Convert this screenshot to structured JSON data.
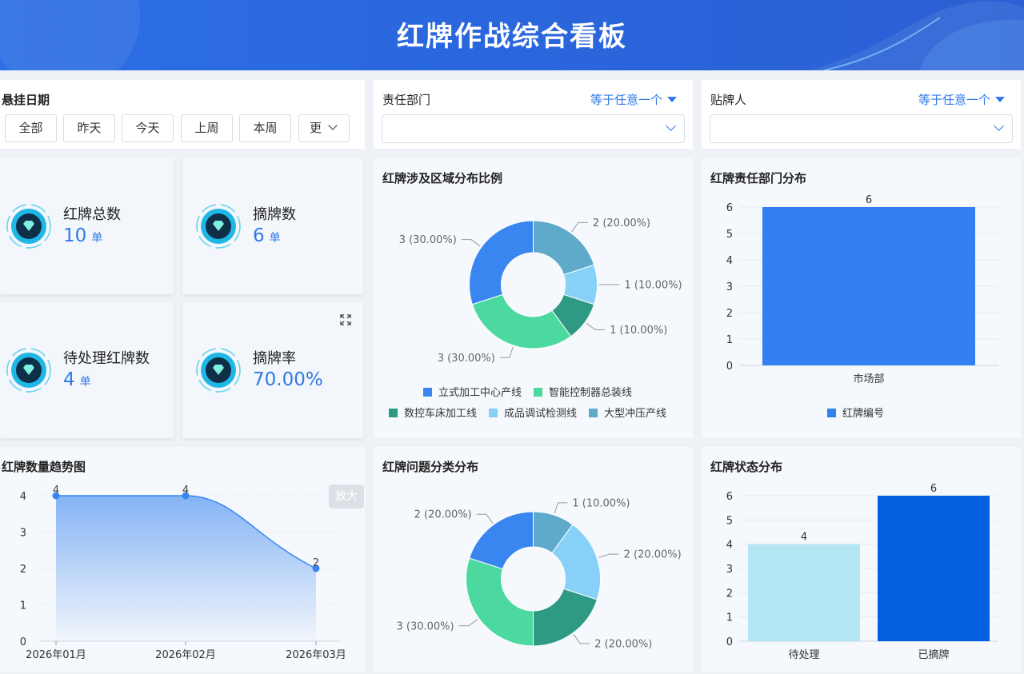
{
  "header": {
    "title": "红牌作战综合看板"
  },
  "filters": {
    "date": {
      "label": "悬挂日期",
      "buttons": [
        "全部",
        "昨天",
        "今天",
        "上周",
        "本周",
        "更"
      ]
    },
    "department": {
      "label": "责任部门",
      "operator": "等于任意一个",
      "value": ""
    },
    "poster": {
      "label": "贴牌人",
      "operator": "等于任意一个",
      "value": ""
    }
  },
  "kpis": [
    {
      "label": "红牌总数",
      "value": "10",
      "unit": "单"
    },
    {
      "label": "摘牌数",
      "value": "6",
      "unit": "单"
    },
    {
      "label": "待处理红牌数",
      "value": "4",
      "unit": "单"
    },
    {
      "label": "摘牌率",
      "value": "70.00%",
      "unit": ""
    }
  ],
  "colors": {
    "accent": "#2f7ae8",
    "blue": "#3a86f0",
    "green": "#4cd9a0",
    "teal": "#2e9a84",
    "lightblue": "#87d0f8",
    "slate": "#5faacb",
    "bar_blue": "#3381f0",
    "bar_light": "#b5e6f3",
    "bar_dark": "#0560e0"
  },
  "charts": {
    "region": {
      "title": "红牌涉及区域分布比例"
    },
    "dept": {
      "title": "红牌责任部门分布"
    },
    "trend": {
      "title": "红牌数量趋势图",
      "zoom_tip": "放大"
    },
    "issue": {
      "title": "红牌问题分类分布"
    },
    "status": {
      "title": "红牌状态分布"
    }
  },
  "chart_data": [
    {
      "id": "region",
      "type": "pie",
      "title": "红牌涉及区域分布比例",
      "slices": [
        {
          "name": "大型冲压产线",
          "value": 2,
          "label": "2 (20.00%)",
          "color": "#5faacb"
        },
        {
          "name": "成品调试检测线",
          "value": 1,
          "label": "1 (10.00%)",
          "color": "#87d0f8"
        },
        {
          "name": "数控车床加工线",
          "value": 1,
          "label": "1 (10.00%)",
          "color": "#2e9a84"
        },
        {
          "name": "智能控制器总装线",
          "value": 3,
          "label": "3 (30.00%)",
          "color": "#4cd9a0"
        },
        {
          "name": "立式加工中心产线",
          "value": 3,
          "label": "3 (30.00%)",
          "color": "#3a86f0"
        }
      ],
      "legend": [
        {
          "name": "立式加工中心产线",
          "color": "#3a86f0"
        },
        {
          "name": "智能控制器总装线",
          "color": "#4cd9a0"
        },
        {
          "name": "数控车床加工线",
          "color": "#2e9a84"
        },
        {
          "name": "成品调试检测线",
          "color": "#87d0f8"
        },
        {
          "name": "大型冲压产线",
          "color": "#5faacb"
        }
      ]
    },
    {
      "id": "dept",
      "type": "bar",
      "title": "红牌责任部门分布",
      "categories": [
        "市场部"
      ],
      "series": [
        {
          "name": "红牌编号",
          "values": [
            6
          ],
          "color": "#3381f0"
        }
      ],
      "ylim": [
        0,
        6
      ],
      "yticks": [
        "0",
        "1",
        "2",
        "3",
        "4",
        "5",
        "6"
      ],
      "legend_position": "bottom"
    },
    {
      "id": "trend",
      "type": "area",
      "title": "红牌数量趋势图",
      "categories": [
        "2026年01月",
        "2026年02月",
        "2026年03月"
      ],
      "values": [
        4,
        4,
        2
      ],
      "ylim": [
        0,
        4
      ],
      "yticks": [
        "0",
        "1",
        "2",
        "3",
        "4"
      ]
    },
    {
      "id": "issue",
      "type": "pie",
      "title": "红牌问题分类分布",
      "slices": [
        {
          "value": 1,
          "label": "1 (10.00%)",
          "color": "#5faacb"
        },
        {
          "value": 2,
          "label": "2 (20.00%)",
          "color": "#87d0f8"
        },
        {
          "value": 2,
          "label": "2 (20.00%)",
          "color": "#2e9a84"
        },
        {
          "value": 3,
          "label": "3 (30.00%)",
          "color": "#4cd9a0"
        },
        {
          "value": 2,
          "label": "2 (20.00%)",
          "color": "#3a86f0"
        }
      ]
    },
    {
      "id": "status",
      "type": "bar",
      "title": "红牌状态分布",
      "categories": [
        "待处理",
        "已摘牌"
      ],
      "values": [
        4,
        6
      ],
      "colors": [
        "#b5e6f3",
        "#0560e0"
      ],
      "ylim": [
        0,
        6
      ],
      "yticks": [
        "0",
        "1",
        "2",
        "3",
        "4",
        "5",
        "6"
      ]
    }
  ]
}
